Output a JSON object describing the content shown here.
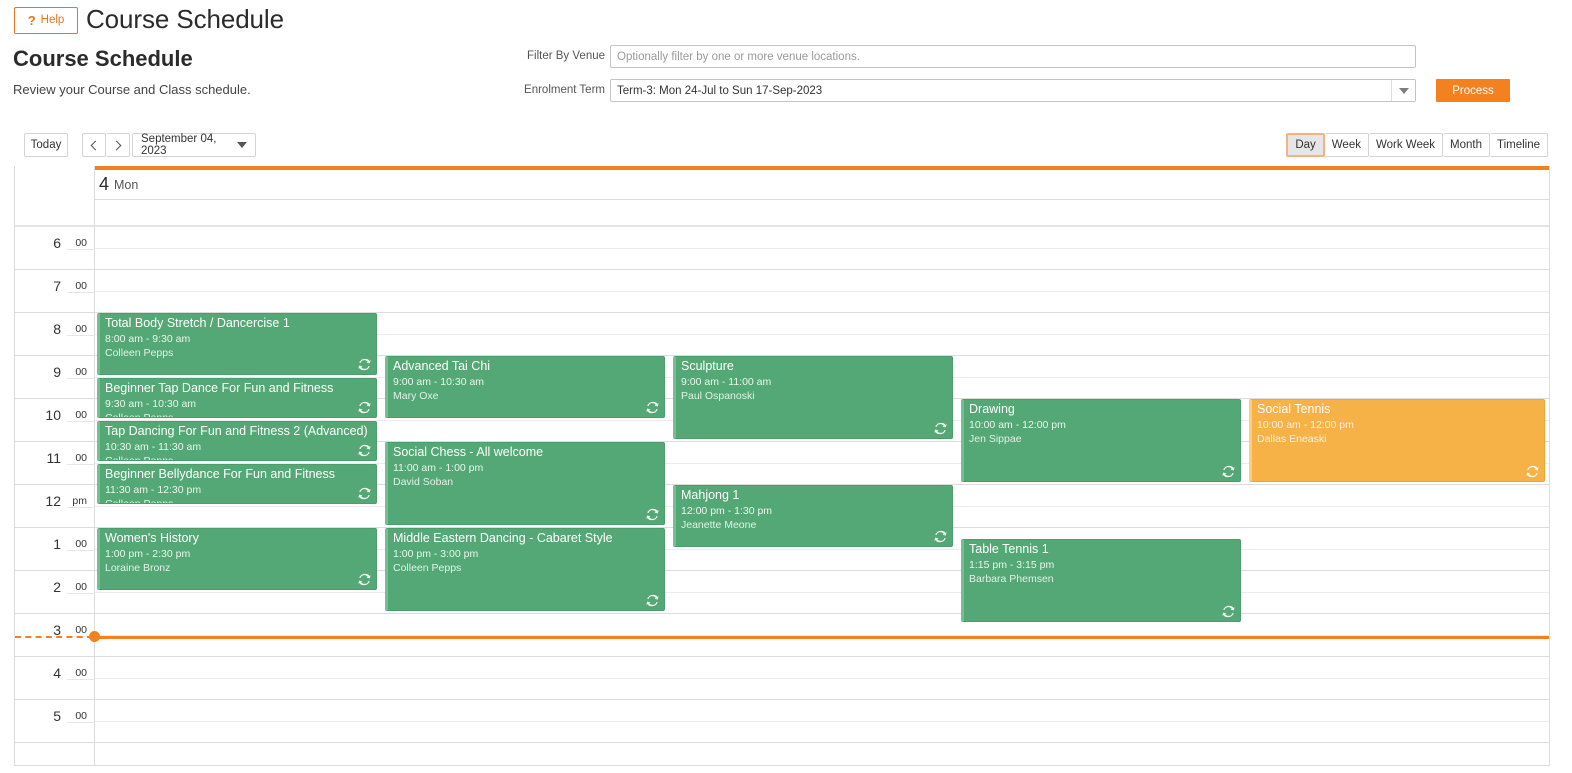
{
  "header": {
    "help_label": "Help",
    "help_icon": "question-mark-icon",
    "app_title": "Course Schedule"
  },
  "page": {
    "title": "Course Schedule",
    "subtitle": "Review your Course and Class schedule."
  },
  "filters": {
    "venue_label": "Filter By Venue",
    "venue_value": "",
    "venue_placeholder": "Optionally filter by one or more venue locations.",
    "term_label": "Enrolment Term",
    "term_value": "Term-3: Mon 24-Jul to Sun 17-Sep-2023",
    "process_label": "Process"
  },
  "toolbar": {
    "today_label": "Today",
    "prev_icon": "chevron-left-icon",
    "next_icon": "chevron-right-icon",
    "date_label": "September 04, 2023",
    "views": [
      {
        "label": "Day",
        "selected": true
      },
      {
        "label": "Week",
        "selected": false
      },
      {
        "label": "Work Week",
        "selected": false
      },
      {
        "label": "Month",
        "selected": false
      },
      {
        "label": "Timeline",
        "selected": false
      }
    ]
  },
  "calendar": {
    "day_number": "4",
    "day_of_week": "Mon",
    "hours": [
      {
        "num": "6",
        "suffix": "00"
      },
      {
        "num": "7",
        "suffix": "00"
      },
      {
        "num": "8",
        "suffix": "00"
      },
      {
        "num": "9",
        "suffix": "00"
      },
      {
        "num": "10",
        "suffix": "00"
      },
      {
        "num": "11",
        "suffix": "00"
      },
      {
        "num": "12",
        "suffix": "pm"
      },
      {
        "num": "1",
        "suffix": "00"
      },
      {
        "num": "2",
        "suffix": "00"
      },
      {
        "num": "3",
        "suffix": "00"
      },
      {
        "num": "4",
        "suffix": "00"
      },
      {
        "num": "5",
        "suffix": "00"
      }
    ],
    "current_time_indicator": "3:30 pm",
    "colors": {
      "accent": "#f4811f",
      "event_green": "#54a875",
      "event_orange": "#f6b247"
    },
    "events": [
      {
        "title": "Total Body Stretch / Dancercise 1",
        "time": "8:00 am - 9:30 am",
        "person": "Colleen Pepps",
        "color": "green",
        "col": 0,
        "start": 8.0,
        "end": 9.5
      },
      {
        "title": "Beginner Tap Dance For Fun and Fitness",
        "time": "9:30 am - 10:30 am",
        "person": "Colleen Pepps",
        "color": "green",
        "col": 0,
        "start": 9.5,
        "end": 10.5
      },
      {
        "title": "Tap Dancing For Fun and Fitness 2 (Advanced)",
        "time": "10:30 am - 11:30 am",
        "person": "Colleen Pepps",
        "color": "green",
        "col": 0,
        "start": 10.5,
        "end": 11.5
      },
      {
        "title": "Beginner Bellydance For Fun and Fitness",
        "time": "11:30 am - 12:30 pm",
        "person": "Colleen Pepps",
        "color": "green",
        "col": 0,
        "start": 11.5,
        "end": 12.5
      },
      {
        "title": "Women's History",
        "time": "1:00 pm - 2:30 pm",
        "person": "Loraine Bronz",
        "color": "green",
        "col": 0,
        "start": 13.0,
        "end": 14.5
      },
      {
        "title": "Advanced Tai Chi",
        "time": "9:00 am - 10:30 am",
        "person": "Mary Oxe",
        "color": "green",
        "col": 1,
        "start": 9.0,
        "end": 10.5
      },
      {
        "title": "Social Chess - All welcome",
        "time": "11:00 am - 1:00 pm",
        "person": "David Soban",
        "color": "green",
        "col": 1,
        "start": 11.0,
        "end": 13.0
      },
      {
        "title": "Middle Eastern Dancing - Cabaret Style",
        "time": "1:00 pm - 3:00 pm",
        "person": "Colleen Pepps",
        "color": "green",
        "col": 1,
        "start": 13.0,
        "end": 15.0
      },
      {
        "title": "Sculpture",
        "time": "9:00 am - 11:00 am",
        "person": "Paul Ospanoski",
        "color": "green",
        "col": 2,
        "start": 9.0,
        "end": 11.0
      },
      {
        "title": "Mahjong 1",
        "time": "12:00 pm - 1:30 pm",
        "person": "Jeanette Meone",
        "color": "green",
        "col": 2,
        "start": 12.0,
        "end": 13.5
      },
      {
        "title": "Drawing",
        "time": "10:00 am - 12:00 pm",
        "person": "Jen Sippae",
        "color": "green",
        "col": 3,
        "start": 10.0,
        "end": 12.0
      },
      {
        "title": "Table Tennis 1",
        "time": "1:15 pm - 3:15 pm",
        "person": "Barbara Phemsen",
        "color": "green",
        "col": 3,
        "start": 13.25,
        "end": 15.25
      },
      {
        "title": "Social Tennis",
        "time": "10:00 am - 12:00 pm",
        "person": "Dallas Eneaski",
        "color": "orange",
        "col": 4,
        "start": 10.0,
        "end": 12.0
      }
    ]
  }
}
